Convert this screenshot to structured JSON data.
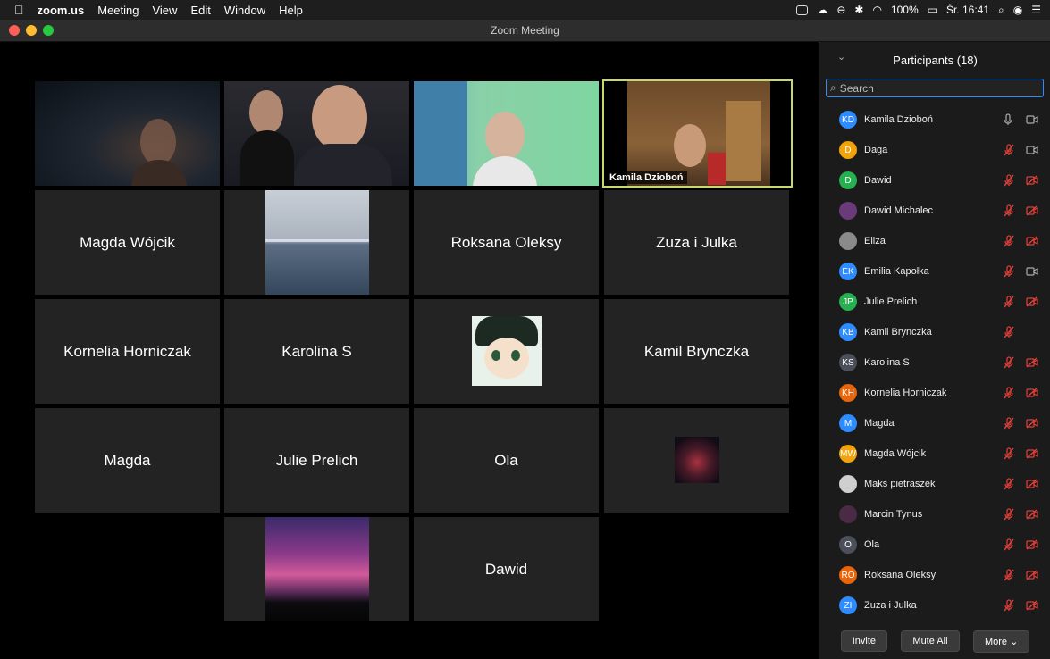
{
  "menubar": {
    "app": "zoom.us",
    "items": [
      "Meeting",
      "View",
      "Edit",
      "Window",
      "Help"
    ],
    "battery": "100%",
    "clock": "Śr. 16:41"
  },
  "window": {
    "title": "Zoom Meeting"
  },
  "video_tiles": [
    {
      "id": "v1",
      "label": ""
    },
    {
      "id": "v2",
      "label": ""
    },
    {
      "id": "v3",
      "label": ""
    },
    {
      "id": "v4",
      "label": "Kamila Dzioboń"
    }
  ],
  "name_tiles": {
    "t_magda_wojcik": "Magda Wójcik",
    "t_roksana": "Roksana Oleksy",
    "t_zuza": "Zuza i Julka",
    "t_kornelia": "Kornelia Horniczak",
    "t_karolina": "Karolina S",
    "t_kamil": "Kamil Brynczka",
    "t_magda": "Magda",
    "t_julie": "Julie Prelich",
    "t_ola": "Ola",
    "t_dawid": "Dawid"
  },
  "panel": {
    "title": "Participants (18)",
    "search_placeholder": "Search",
    "participants": [
      {
        "initials": "KD",
        "name": "Kamila Dzioboń",
        "color": "#2d8cff",
        "mic": "on",
        "cam": "on"
      },
      {
        "initials": "D",
        "name": "Daga",
        "color": "#f0a30a",
        "mic": "off",
        "cam": "on"
      },
      {
        "initials": "D",
        "name": "Dawid",
        "color": "#26b04f",
        "mic": "off",
        "cam": "off"
      },
      {
        "initials": "",
        "name": "Dawid Michalec",
        "color": "#6b3a7a",
        "mic": "off",
        "cam": "off"
      },
      {
        "initials": "",
        "name": "Eliza",
        "color": "#8a8a8a",
        "mic": "off",
        "cam": "off"
      },
      {
        "initials": "EK",
        "name": "Emilia Kapołka",
        "color": "#2d8cff",
        "mic": "off",
        "cam": "on"
      },
      {
        "initials": "JP",
        "name": "Julie Prelich",
        "color": "#26b04f",
        "mic": "off",
        "cam": "off"
      },
      {
        "initials": "KB",
        "name": "Kamil Brynczka",
        "color": "#2d8cff",
        "mic": "off",
        "cam": "none"
      },
      {
        "initials": "KS",
        "name": "Karolina S",
        "color": "#4a4f5a",
        "mic": "off",
        "cam": "off"
      },
      {
        "initials": "KH",
        "name": "Kornelia Horniczak",
        "color": "#e8650c",
        "mic": "off",
        "cam": "off"
      },
      {
        "initials": "M",
        "name": "Magda",
        "color": "#2d8cff",
        "mic": "off",
        "cam": "off"
      },
      {
        "initials": "MW",
        "name": "Magda Wójcik",
        "color": "#f0a30a",
        "mic": "off",
        "cam": "off"
      },
      {
        "initials": "",
        "name": "Maks pietraszek",
        "color": "#cfcfcf",
        "mic": "off",
        "cam": "off"
      },
      {
        "initials": "",
        "name": "Marcin Tynus",
        "color": "#4a2a44",
        "mic": "off",
        "cam": "off"
      },
      {
        "initials": "O",
        "name": "Ola",
        "color": "#4a4f5a",
        "mic": "off",
        "cam": "off"
      },
      {
        "initials": "RO",
        "name": "Roksana Oleksy",
        "color": "#e8650c",
        "mic": "off",
        "cam": "off"
      },
      {
        "initials": "ZI",
        "name": "Zuza i Julka",
        "color": "#2d8cff",
        "mic": "off",
        "cam": "off"
      }
    ],
    "buttons": {
      "invite": "Invite",
      "mute_all": "Mute All",
      "more": "More ⌄"
    }
  }
}
